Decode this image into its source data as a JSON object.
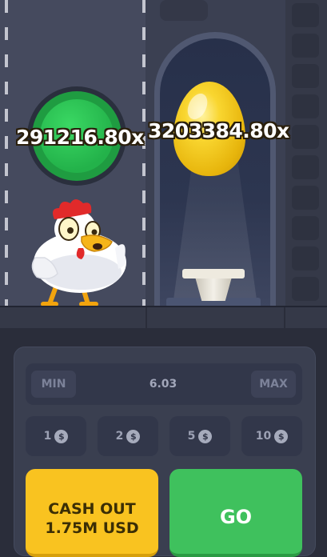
{
  "game": {
    "multipliers": {
      "current": "291216.80x",
      "next": "3203384.80x"
    }
  },
  "controls": {
    "min_label": "MIN",
    "max_label": "MAX",
    "bet_value": "6.03",
    "quick_bets": [
      "1",
      "2",
      "5",
      "10"
    ],
    "currency_icon": "dollar-coin-icon",
    "cashout": {
      "line1": "CASH OUT",
      "line2": "1.75M USD"
    },
    "go_label": "GO"
  },
  "colors": {
    "cashout": "#f9c320",
    "go": "#3fc15d",
    "coin": "#23b24a",
    "egg": "#f9d630"
  }
}
